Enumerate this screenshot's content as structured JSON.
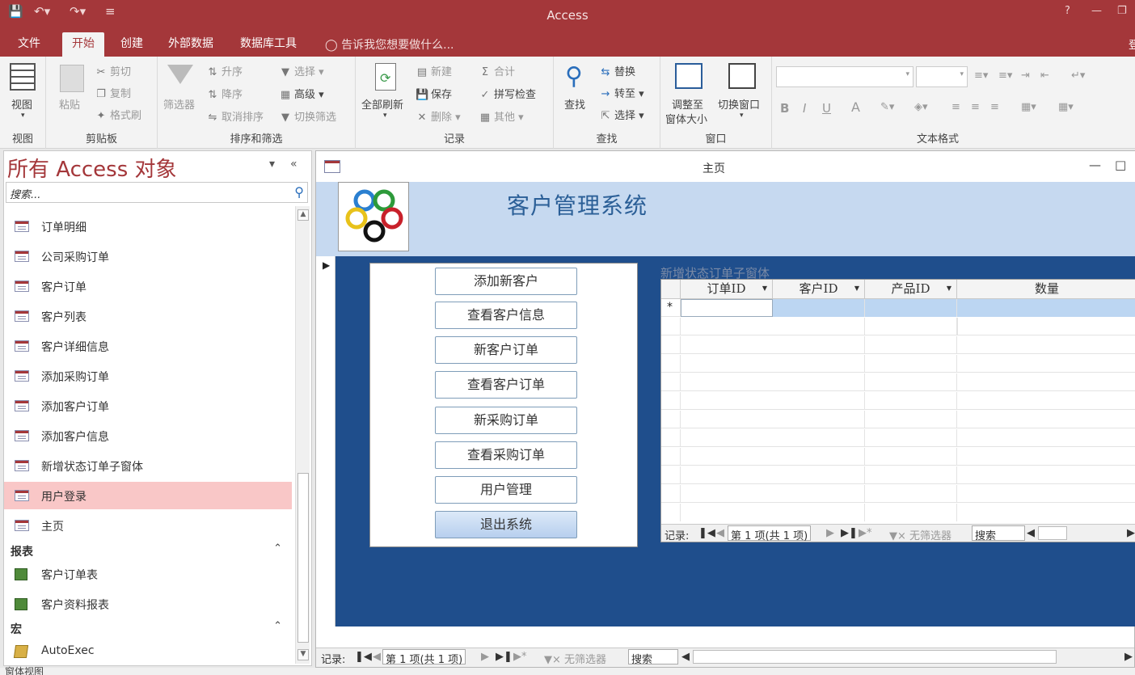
{
  "app": {
    "title": "Access",
    "help": "?",
    "user_char": "登"
  },
  "menu": {
    "tabs": [
      "文件",
      "开始",
      "创建",
      "外部数据",
      "数据库工具"
    ],
    "active": "开始",
    "tell_me": "告诉我您想要做什么..."
  },
  "ribbon": {
    "view": {
      "btn": "视图",
      "group": "视图"
    },
    "clipboard": {
      "paste": "粘贴",
      "cut": "剪切",
      "copy": "复制",
      "format_painter": "格式刷",
      "group": "剪贴板"
    },
    "sort_filter": {
      "filter": "筛选器",
      "asc": "升序",
      "desc": "降序",
      "clear_sort": "取消排序",
      "selection": "选择",
      "advanced": "高级",
      "toggle_filter": "切换筛选",
      "group": "排序和筛选"
    },
    "records": {
      "refresh": "全部刷新",
      "new": "新建",
      "save": "保存",
      "delete": "删除",
      "totals": "合计",
      "spelling": "拼写检查",
      "more": "其他",
      "group": "记录"
    },
    "find": {
      "find": "查找",
      "replace": "替换",
      "goto": "转至",
      "select": "选择",
      "group": "查找"
    },
    "window": {
      "size_to_fit": "调整至\n窗体大小",
      "size_line1": "调整至",
      "size_line2": "窗体大小",
      "switch": "切换窗口",
      "group": "窗口"
    },
    "text_format": {
      "bold": "B",
      "italic": "I",
      "underline": "U",
      "font_color": "A",
      "group": "文本格式"
    }
  },
  "nav": {
    "title": "所有 Access 对象",
    "search_placeholder": "搜索...",
    "forms": [
      "订单明细",
      "公司采购订单",
      "客户订单",
      "客户列表",
      "客户详细信息",
      "添加采购订单",
      "添加客户订单",
      "添加客户信息",
      "新增状态订单子窗体",
      "用户登录",
      "主页"
    ],
    "selected": "用户登录",
    "reports_header": "报表",
    "reports": [
      "客户订单表",
      "客户资料报表"
    ],
    "macros_header": "宏",
    "macros": [
      "AutoExec"
    ]
  },
  "form": {
    "window_title": "主页",
    "system_title": "客户管理系统",
    "buttons": [
      "添加新客户",
      "查看客户信息",
      "新客户订单",
      "查看客户订单",
      "新采购订单",
      "查看采购订单",
      "用户管理",
      "退出系统"
    ],
    "subform_label": "新增状态订单子窗体",
    "columns": [
      "订单ID",
      "客户ID",
      "产品ID",
      "数量"
    ],
    "new_row_marker": "*",
    "sub_nav": {
      "label": "记录:",
      "position": "第 1 项(共 1 项)",
      "no_filter": "无筛选器",
      "search": "搜索"
    },
    "main_nav": {
      "label": "记录:",
      "position": "第 1 项(共 1 项)",
      "no_filter": "无筛选器",
      "search": "搜索"
    }
  },
  "status": {
    "text": "窗体视图"
  },
  "colors": {
    "access_red": "#a4373a",
    "form_header_blue": "#c6d9f0",
    "detail_blue": "#1f4e8c",
    "selected_nav": "#f9c7c7"
  }
}
